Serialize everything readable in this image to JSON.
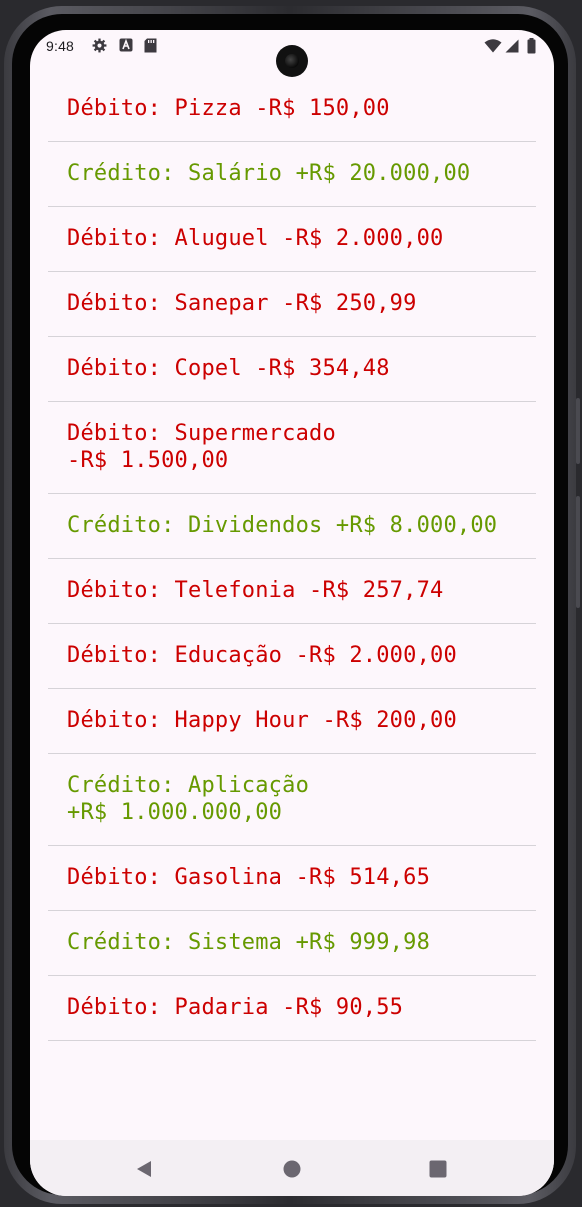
{
  "status_bar": {
    "time": "9:48",
    "icons": [
      "settings-gear-icon",
      "a-badge-icon",
      "sd-card-icon",
      "wifi-icon",
      "signal-icon",
      "battery-icon"
    ]
  },
  "transactions": [
    {
      "type": "debito",
      "lines": [
        "Débito: Pizza -R$ 150,00"
      ]
    },
    {
      "type": "credito",
      "lines": [
        "Crédito: Salário +R$ 20.000,00"
      ]
    },
    {
      "type": "debito",
      "lines": [
        "Débito: Aluguel -R$ 2.000,00"
      ]
    },
    {
      "type": "debito",
      "lines": [
        "Débito: Sanepar -R$ 250,99"
      ]
    },
    {
      "type": "debito",
      "lines": [
        "Débito: Copel -R$ 354,48"
      ]
    },
    {
      "type": "debito",
      "lines": [
        "Débito: Supermercado",
        "-R$ 1.500,00"
      ]
    },
    {
      "type": "credito",
      "lines": [
        "Crédito: Dividendos +R$ 8.000,00"
      ]
    },
    {
      "type": "debito",
      "lines": [
        "Débito: Telefonia -R$ 257,74"
      ]
    },
    {
      "type": "debito",
      "lines": [
        "Débito: Educação -R$ 2.000,00"
      ]
    },
    {
      "type": "debito",
      "lines": [
        "Débito: Happy Hour -R$ 200,00"
      ]
    },
    {
      "type": "credito",
      "lines": [
        "Crédito: Aplicação",
        "+R$ 1.000.000,00"
      ]
    },
    {
      "type": "debito",
      "lines": [
        "Débito: Gasolina -R$ 514,65"
      ]
    },
    {
      "type": "credito",
      "lines": [
        "Crédito: Sistema +R$ 999,98"
      ]
    },
    {
      "type": "debito",
      "lines": [
        "Débito: Padaria -R$ 90,55"
      ]
    }
  ],
  "colors": {
    "debito": "#cc0000",
    "credito": "#669900",
    "background": "#fdf7fc",
    "divider": "#d6d3d8"
  },
  "nav_bar": {
    "buttons": [
      "back-icon",
      "home-icon",
      "recents-icon"
    ]
  }
}
